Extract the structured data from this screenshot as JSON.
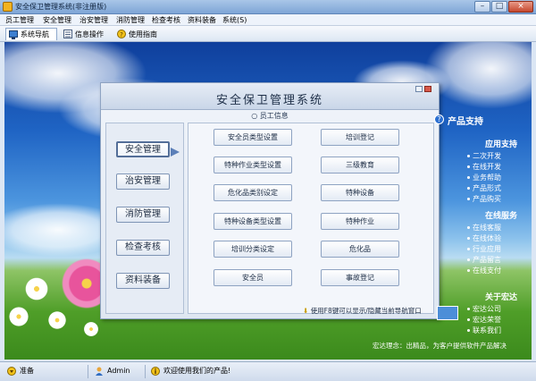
{
  "window": {
    "title": "安全保卫管理系统(非注册版)",
    "min": "–",
    "max": "□",
    "close": "×"
  },
  "menu": [
    "员工管理",
    "安全管理",
    "治安管理",
    "消防管理",
    "检查考核",
    "资料装备",
    "系统(S)"
  ],
  "toolbar": {
    "nav": "系统导航",
    "info": "信息操作",
    "guide": "使用指南"
  },
  "panel": {
    "title": "安全保卫管理系统",
    "subtitle": "员工信息",
    "nav": [
      "安全管理",
      "治安管理",
      "消防管理",
      "检查考核",
      "资料装备"
    ],
    "functions": [
      "安全员类型设置",
      "培训登记",
      "特种作业类型设置",
      "三级教育",
      "危化品类别设定",
      "特种设备",
      "特种设备类型设置",
      "特种作业",
      "培训分类设定",
      "危化品",
      "安全员",
      "事故登记"
    ],
    "hint": "使用F8键可以显示/隐藏当前导航窗口"
  },
  "side": {
    "title": "产品支持",
    "sections": [
      {
        "header": "应用支持",
        "items": [
          "二次开发",
          "在线开发",
          "业务帮助",
          "产品形式",
          "产品购买"
        ]
      },
      {
        "header": "在线服务",
        "items": [
          "在线客服",
          "在线体验",
          "行业应用",
          "产品留言",
          "在线支付"
        ]
      },
      {
        "header": "关于宏达",
        "items": [
          "宏达公司",
          "宏达荣誉",
          "联系我们"
        ]
      }
    ],
    "ticker": "宏达理念：出精品，为客户提供软件产品解决"
  },
  "status": {
    "ready": "准备",
    "user": "Admin",
    "welcome": "欢迎使用我们的产品!"
  },
  "colors": {
    "accent": "#1f64c4",
    "panel": "#e3eaf4"
  }
}
